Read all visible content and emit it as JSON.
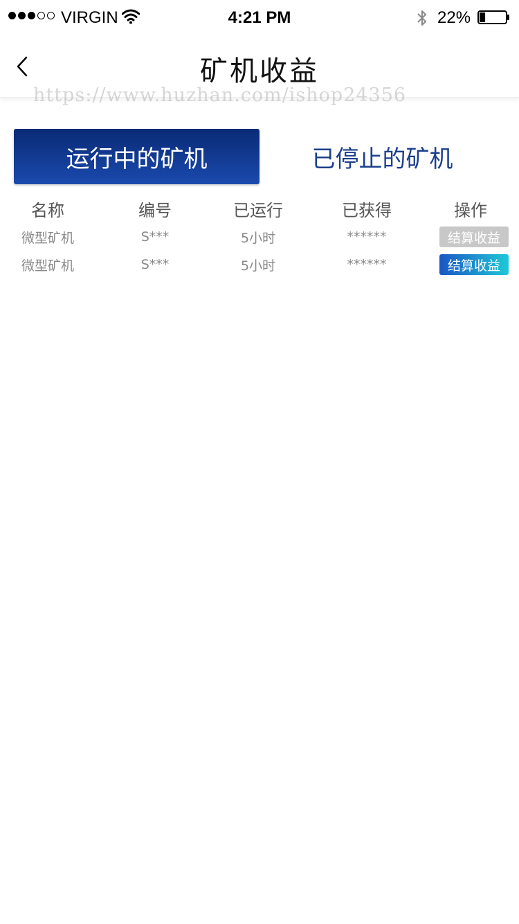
{
  "status_bar": {
    "carrier": "VIRGIN",
    "time": "4:21 PM",
    "battery_percent": "22%",
    "battery_level": 0.22,
    "signal_bars_filled": 3,
    "signal_bars_total": 5,
    "icons": [
      "wifi-icon",
      "bluetooth-icon",
      "battery-icon"
    ]
  },
  "nav": {
    "title": "矿机收益",
    "back_icon": "chevron-left-icon"
  },
  "watermark": "https://www.huzhan.com/ishop24356",
  "tabs": [
    {
      "label": "运行中的矿机",
      "active": true
    },
    {
      "label": "已停止的矿机",
      "active": false
    }
  ],
  "table": {
    "headers": [
      "名称",
      "编号",
      "已运行",
      "已获得",
      "操作"
    ],
    "rows": [
      {
        "name": "微型矿机",
        "code": "S***",
        "runtime": "5小时",
        "earned": "******",
        "action": "结算收益",
        "action_enabled": false
      },
      {
        "name": "微型矿机",
        "code": "S***",
        "runtime": "5小时",
        "earned": "******",
        "action": "结算收益",
        "action_enabled": true
      }
    ]
  },
  "colors": {
    "tab_active_top": "#0a2a75",
    "tab_active_bottom": "#1a4aae",
    "tab_inactive_text": "#1c3f8c",
    "button_disabled": "#c8c8c8",
    "button_enabled_start": "#1a56c4",
    "button_enabled_end": "#1fc8d8"
  }
}
